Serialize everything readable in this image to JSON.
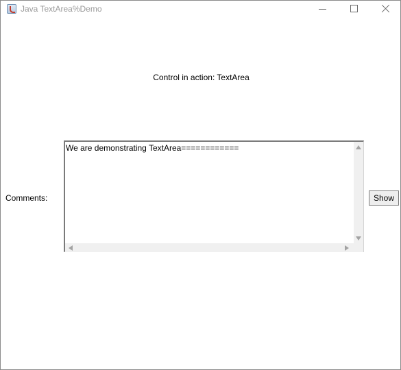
{
  "window": {
    "title": "Java TextArea%Demo",
    "icon": "java-app-icon",
    "controls": {
      "minimize": "minimize-icon",
      "maximize": "maximize-icon",
      "close": "close-icon"
    }
  },
  "main": {
    "heading": "Control in action: TextArea",
    "comments_label": "Comments:",
    "textarea_value": "We are demonstrating TextArea============",
    "show_button": "Show"
  },
  "colors": {
    "title_text": "#9a9a9a",
    "button_bg": "#eeeeee",
    "scrollbar_bg": "#f0f0f0"
  }
}
